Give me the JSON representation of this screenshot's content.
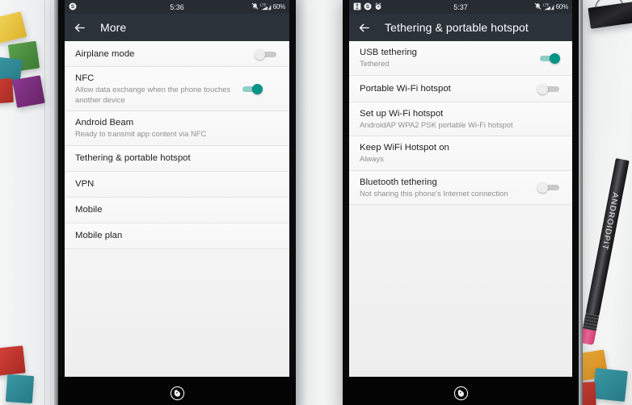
{
  "scene": {
    "background_color": "#eceeee",
    "props": {
      "pencil_label": "ANDROIDPIT",
      "blocks_left": [
        "#e8c43c",
        "#4c8c3f",
        "#2f8a96",
        "#c8342f",
        "#7d2f84"
      ],
      "blocks_right": [
        "#e8a62c",
        "#2f8a96",
        "#c8342f"
      ]
    }
  },
  "phones": [
    {
      "id": "phone-left",
      "status_bar": {
        "icons_left": [
          "skype-icon"
        ],
        "clock": "5:36",
        "icons_right": [
          "mute-icon",
          "lte-signal-icon"
        ],
        "battery": "60%"
      },
      "app_bar": {
        "back_icon": "back-arrow-icon",
        "title": "More"
      },
      "rows": [
        {
          "title": "Airplane mode",
          "subtitle": "",
          "control": "toggle",
          "toggle_on": false
        },
        {
          "title": "NFC",
          "subtitle": "Allow data exchange when the phone touches another device",
          "control": "toggle",
          "toggle_on": true
        },
        {
          "title": "Android Beam",
          "subtitle": "Ready to transmit app content via NFC",
          "control": "none",
          "toggle_on": false
        },
        {
          "title": "Tethering & portable hotspot",
          "subtitle": "",
          "control": "none",
          "toggle_on": false
        },
        {
          "title": "VPN",
          "subtitle": "",
          "control": "none",
          "toggle_on": false
        },
        {
          "title": "Mobile",
          "subtitle": "",
          "control": "none",
          "toggle_on": false
        },
        {
          "title": "Mobile plan",
          "subtitle": "",
          "control": "none",
          "toggle_on": false
        }
      ],
      "nav_logo": "fox-head-logo"
    },
    {
      "id": "phone-right",
      "status_bar": {
        "icons_left": [
          "usb-tethering-icon",
          "skype-icon",
          "alarm-icon"
        ],
        "clock": "5:37",
        "icons_right": [
          "mute-icon",
          "lte-signal-icon"
        ],
        "battery": "60%"
      },
      "app_bar": {
        "back_icon": "back-arrow-icon",
        "title": "Tethering & portable hotspot"
      },
      "rows": [
        {
          "title": "USB tethering",
          "subtitle": "Tethered",
          "control": "toggle",
          "toggle_on": true
        },
        {
          "title": "Portable Wi-Fi hotspot",
          "subtitle": "",
          "control": "toggle",
          "toggle_on": false
        },
        {
          "title": "Set up Wi-Fi hotspot",
          "subtitle": "AndroidAP WPA2 PSK portable Wi-Fi hotspot",
          "control": "none",
          "toggle_on": false
        },
        {
          "title": "Keep WiFi Hotspot on",
          "subtitle": "Always",
          "control": "none",
          "toggle_on": false
        },
        {
          "title": "Bluetooth tethering",
          "subtitle": "Not sharing this phone's Internet connection",
          "control": "toggle",
          "toggle_on": false
        }
      ],
      "nav_logo": "fox-head-logo"
    }
  ],
  "colors": {
    "status_bar": "#272c33",
    "app_bar": "#2b323a",
    "toggle_on": "#009486",
    "toggle_on_track": "#8fcdc6",
    "toggle_off": "#ededed",
    "list_bg": "#f6f6f6",
    "primary_text": "#212121",
    "secondary_text": "#8e8e8e"
  }
}
